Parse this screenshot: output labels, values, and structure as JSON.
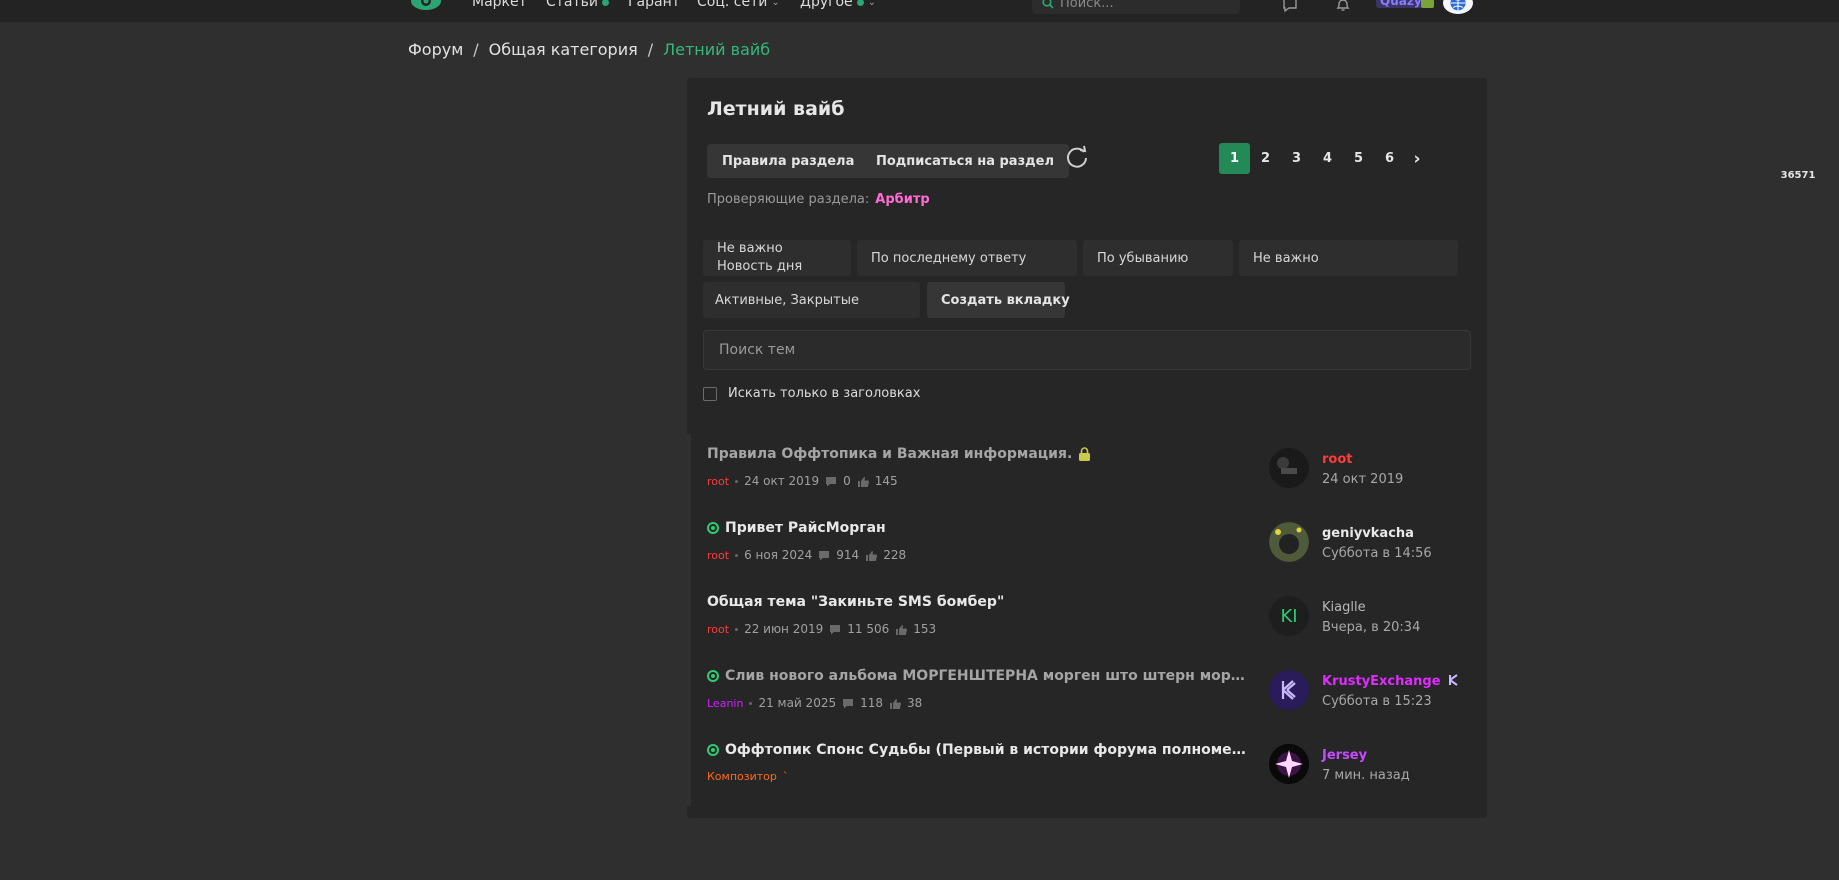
{
  "nav": {
    "items": [
      {
        "label": "Маркет"
      },
      {
        "label": "Статьи"
      },
      {
        "label": "Гарант"
      },
      {
        "label": "Соц. сети"
      },
      {
        "label": "Другое"
      }
    ],
    "search_placeholder": "Поиск...",
    "user_tag": "Quazy"
  },
  "breadcrumb": {
    "forum": "Форум",
    "category": "Общая категория",
    "current": "Летний вайб",
    "sep": "/"
  },
  "panel": {
    "title": "Летний вайб",
    "rules_button": "Правила раздела",
    "subscribe_button": "Подписаться на раздел",
    "pages": [
      "1",
      "2",
      "3",
      "4",
      "5",
      "6"
    ],
    "next_symbol": "›",
    "last_page": "36571",
    "active_page": "1",
    "moderators_label": "Проверяющие раздела:",
    "moderator": "Арбитр"
  },
  "filters": {
    "importance_line1": "Не важно",
    "importance_line2": "Новость дня",
    "sort_by": "По последнему ответу",
    "order": "По убыванию",
    "prefix": "Не важно",
    "state": "Активные, Закрытые",
    "create_tab": "Создать вкладку",
    "search_placeholder": "Поиск тем",
    "titles_only": "Искать только в заголовках"
  },
  "threads": [
    {
      "title": "Правила Оффтопика и Важная информация.",
      "author": "root",
      "author_color": "#ff3b3b",
      "date": "24 окт 2019",
      "replies": "0",
      "likes": "145",
      "last_user": "root",
      "last_user_color": "#ff3b3b",
      "last_time": "24 окт 2019",
      "icon": "lock-icon",
      "unread": false
    },
    {
      "title": "Привет РайсМорган",
      "author": "root",
      "author_color": "#ff3b3b",
      "date": "6 ноя 2024",
      "replies": "914",
      "likes": "228",
      "last_user": "geniyvkacha",
      "last_user_color": "#e8e8e8",
      "last_time": "Суббота в 14:56",
      "icon": "unread-ring-icon",
      "unread": true
    },
    {
      "title": "Общая тема \"Закиньте SMS бомбер\"",
      "author": "root",
      "author_color": "#ff3b3b",
      "date": "22 июн 2019",
      "replies": "11 506",
      "likes": "153",
      "last_user": "Kiaglle",
      "last_user_color": "#b8b8b8",
      "last_time": "Вчера, в 20:34",
      "avatar_text": "KI",
      "unread": false
    },
    {
      "title": "Слив нового альбома МОРГЕНШТЕРНА морген што штерн моргеншпека",
      "author": "Leanin",
      "author_color": "#d21fff",
      "date": "21 май 2025",
      "replies": "118",
      "likes": "38",
      "last_user": "KrustyExchange",
      "last_user_color": "#e02bff",
      "last_time": "Суббота в 15:23",
      "icon": "unread-ring-icon",
      "unread": true
    },
    {
      "title": "Оффтопик Спонс Судьбы (Первый в истории форума полнометражный ...",
      "author": "Композитор",
      "author_color": "#ff6a1f",
      "date": "",
      "replies": "",
      "likes": "",
      "last_user": "Jersey",
      "last_user_color": "#c64bff",
      "last_time": "7 мин. назад",
      "icon": "unread-ring-icon",
      "unread": true
    }
  ],
  "colors": {
    "background": "#2f2f2f",
    "panel": "#262626",
    "accent_green": "#238a57",
    "link_green": "#33b97a"
  }
}
